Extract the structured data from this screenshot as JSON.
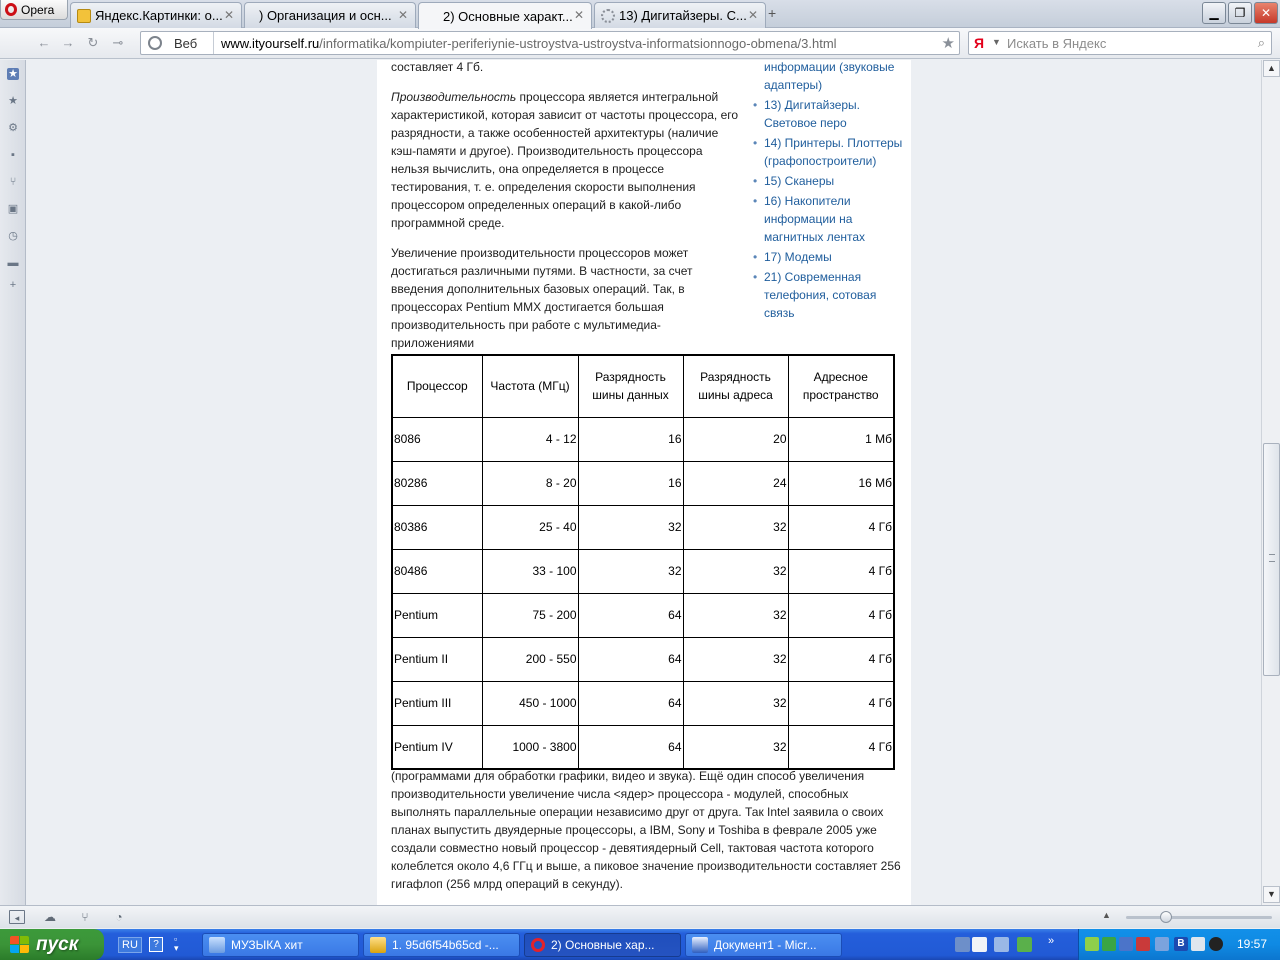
{
  "browser": {
    "menu_label": "Opera",
    "tabs": [
      {
        "label": "Яндекс.Картинки: о..."
      },
      {
        "label": ") Организация и осн..."
      },
      {
        "label": "2) Основные характ..."
      },
      {
        "label": "13) Дигитайзеры. С..."
      }
    ],
    "new_tab_label": "+",
    "address": {
      "mode_label": "Веб",
      "url_domain": "www.ityourself.ru",
      "url_path": "/informatika/kompiuter-periferiynie-ustroystva-ustroystva-informatsionnogo-obmena/3.html"
    },
    "search": {
      "engine_label": "Я",
      "placeholder": "Искать в Яндекс"
    }
  },
  "article": {
    "intro_text": "составляет 4 Гб.",
    "perf_term": "Производительность",
    "perf_text": " процессора является интегральной характеристикой, которая зависит от частоты процессора, его разрядности, а также особенностей архитектуры (наличие кэш-памяти и другое). Производительность процессора нельзя вычислить, она определяется в процессе тестирования, т. е. определения скорости выполнения процессором определенных операций в какой-либо программной среде.",
    "increase_text": "Увеличение производительности процессоров может достигаться различными путями. В частности, за счет введения дополнительных базовых операций. Так, в процессорах Pentium MMX достигается большая производительность при работе с мультимедиа-приложениями",
    "after_text": "(программами для обработки графики, видео и звука). Ещё один способ увеличения производительности увеличение числа <ядер> процессора - модулей, способных выполнять параллельные операции независимо друг от друга. Так Intel заявила о своих планах выпустить двуядерные процессоры, а IBM, Sony и Toshiba в феврале 2005 уже создали совместно новый процессор - девятиядерный Cell, тактовая частота которого колеблется около 4,6 ГГц и выше, а пиковое значение производительности составляет 256 гигафлоп (256 млрд операций в секунду)."
  },
  "toc": [
    {
      "label": "информации (звуковые адаптеры)",
      "continuation": true
    },
    {
      "label": "13) Дигитайзеры. Световое перо"
    },
    {
      "label": "14) Принтеры. Плоттеры (графопостроители)"
    },
    {
      "label": "15) Сканеры"
    },
    {
      "label": "16) Накопители информации на магнитных лентах"
    },
    {
      "label": "17) Модемы"
    },
    {
      "label": "21) Современная телефония, сотовая связь"
    }
  ],
  "table": {
    "headers": [
      "Процессор",
      "Частота (МГц)",
      "Разрядность шины данных",
      "Разрядность шины адреса",
      "Адресное пространство"
    ],
    "rows": [
      [
        "8086",
        "4 - 12",
        "16",
        "20",
        "1 Мб"
      ],
      [
        "80286",
        "8 - 20",
        "16",
        "24",
        "16 Мб"
      ],
      [
        "80386",
        "25 - 40",
        "32",
        "32",
        "4 Гб"
      ],
      [
        "80486",
        "33 - 100",
        "32",
        "32",
        "4 Гб"
      ],
      [
        "Pentium",
        "75 - 200",
        "64",
        "32",
        "4 Гб"
      ],
      [
        "Pentium II",
        "200 - 550",
        "64",
        "32",
        "4 Гб"
      ],
      [
        "Pentium III",
        "450 - 1000",
        "64",
        "32",
        "4 Гб"
      ],
      [
        "Pentium IV",
        "1000 - 3800",
        "64",
        "32",
        "4 Гб"
      ]
    ]
  },
  "taskbar": {
    "start_label": "пуск",
    "lang": "RU",
    "help": "?",
    "tasks": [
      {
        "label": "МУЗЫКА хит",
        "icon": "music-icon"
      },
      {
        "label": "1. 95d6f54b65cd -...",
        "icon": "image-editor-icon"
      },
      {
        "label": "2) Основные хар...",
        "icon": "opera-icon"
      },
      {
        "label": "Документ1 - Micr...",
        "icon": "word-icon"
      }
    ],
    "clock": "19:57"
  },
  "colors": {
    "link": "#1f5d9c",
    "taskbar_blue": "#245edb",
    "start_green": "#3b9438",
    "opera_red": "#cc0f16"
  }
}
